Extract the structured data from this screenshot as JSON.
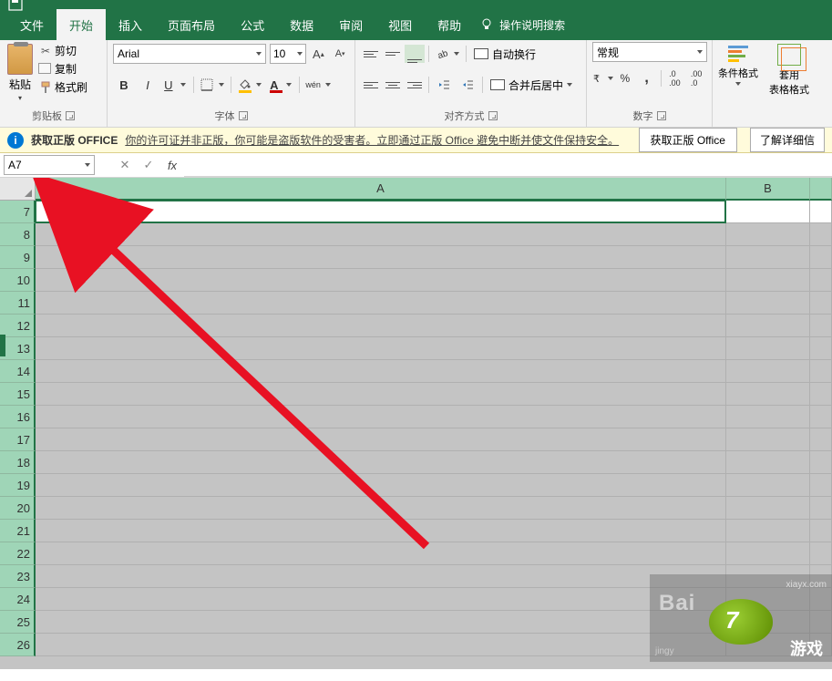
{
  "tabs": {
    "file": "文件",
    "home": "开始",
    "insert": "插入",
    "layout": "页面布局",
    "formula": "公式",
    "data": "数据",
    "review": "审阅",
    "view": "视图",
    "help": "帮助",
    "tell_me": "操作说明搜索"
  },
  "clipboard": {
    "paste": "粘贴",
    "cut": "剪切",
    "copy": "复制",
    "painter": "格式刷",
    "group": "剪贴板"
  },
  "font": {
    "name": "Arial",
    "size": "10",
    "increase": "A",
    "decrease": "A",
    "bold": "B",
    "italic": "I",
    "underline": "U",
    "phonetic": "wén",
    "group": "字体"
  },
  "align": {
    "wrap": "自动换行",
    "merge": "合并后居中",
    "group": "对齐方式"
  },
  "number": {
    "format": "常规",
    "percent": "%",
    "comma": ",",
    "inc_dec": ".00",
    "dec_dec": ".0",
    "group": "数字"
  },
  "styles": {
    "cond": "条件格式",
    "table": "套用\n表格格式"
  },
  "message": {
    "title": "获取正版 OFFICE",
    "text": "你的许可证并非正版，你可能是盗版软件的受害者。立即通过正版 Office 避免中断并使文件保持安全。",
    "btn1": "获取正版 Office",
    "btn2": "了解详细信"
  },
  "namebox": "A7",
  "columns": [
    "A",
    "B",
    ""
  ],
  "rows": [
    "7",
    "8",
    "9",
    "10",
    "11",
    "12",
    "13",
    "14",
    "15",
    "16",
    "17",
    "18",
    "19",
    "20",
    "21",
    "22",
    "23",
    "24",
    "25",
    "26"
  ],
  "active_row": "7",
  "watermark": {
    "url": "xiayx.com",
    "num": "7",
    "chars": "游戏",
    "sub": "jingy",
    "bai": "Bai"
  }
}
